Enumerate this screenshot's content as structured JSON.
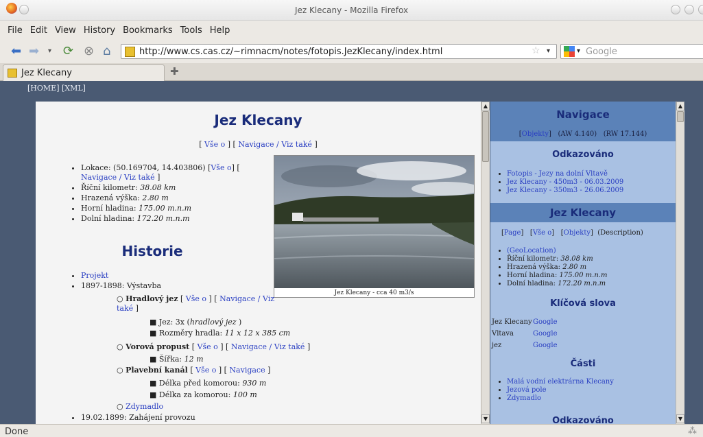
{
  "window": {
    "title": "Jez Klecany - Mozilla Firefox"
  },
  "menu": {
    "items": [
      "File",
      "Edit",
      "View",
      "History",
      "Bookmarks",
      "Tools",
      "Help"
    ]
  },
  "nav": {
    "url": "http://www.cs.cas.cz/~rimnacm/notes/fotopis.JezKlecany/index.html",
    "search_placeholder": "Google"
  },
  "tab": {
    "title": "Jez Klecany"
  },
  "page": {
    "home_links": "[HOME] [XML]",
    "title": "Jez Klecany",
    "top_links": {
      "l1": "Vše o",
      "l2": "Navigace / Viz také"
    },
    "loc": {
      "text": "Lokace: (50.169704, 14.403806) [",
      "l1": "Vše o",
      "mid": "] [",
      "l2": "Navigace / Viz také",
      "end": "]"
    },
    "facts": [
      {
        "label": "Říční kilometr: ",
        "value": "38.08 km"
      },
      {
        "label": "Hrazená výška: ",
        "value": "2.80 m"
      },
      {
        "label": "Horní hladina: ",
        "value": "175.00 m.n.m"
      },
      {
        "label": "Dolní hladina: ",
        "value": "172.20 m.n.m"
      }
    ],
    "photo_caption": "Jez Klecany - cca 40 m3/s",
    "history_title": "Historie",
    "history": {
      "projekt": "Projekt",
      "year1": "1897-1898: Výstavba",
      "hradlovy": {
        "name": "Hradlový jez",
        "l1": "Vše o",
        "l2": "Navigace / Viz také"
      },
      "jez": {
        "label": "Jez: 3x (",
        "value": "hradlový jez",
        "end": " )"
      },
      "rozmery": {
        "label": "Rozměry hradla: ",
        "value": "11 x 12 x 385 cm"
      },
      "vorova": {
        "name": "Vorová propust",
        "l1": "Vše o",
        "l2": "Navigace / Viz také"
      },
      "sirka": {
        "label": "Šířka: ",
        "value": "12 m"
      },
      "plavebni": {
        "name": "Plavební kanál",
        "l1": "Vše o",
        "l2": "Navigace"
      },
      "delka_pred": {
        "label": "Délka před komorou: ",
        "value": "930 m"
      },
      "delka_za": {
        "label": "Délka za komorou: ",
        "value": "100 m"
      },
      "zdymadlo": "Zdymadlo",
      "year2": "19.02.1899: Zahájení provozu"
    }
  },
  "side": {
    "nav_title": "Navigace",
    "nav_row": {
      "objekty": "Objekty",
      "aw": "(AW 4.140)",
      "rw": "(RW 17.144)"
    },
    "odkaz_title": "Odkazováno",
    "odkaz": [
      "Fotopis - Jezy na dolní Vltavě",
      "Jez Klecany - 450m3 - 06.03.2009",
      "Jez Klecany - 350m3 - 26.06.2009"
    ],
    "jez_title": "Jez Klecany",
    "jez_row": {
      "page": "Page",
      "vse": "Vše o",
      "objekty": "Objekty",
      "desc": "(Description)"
    },
    "jez_items": {
      "geo": "(GeoLocation)",
      "km": {
        "label": "Říční kilometr: ",
        "value": "38.08 km"
      },
      "vyska": {
        "label": "Hrazená výška: ",
        "value": "2.80 m"
      },
      "horni": {
        "label": "Horní hladina: ",
        "value": "175.00 m.n.m"
      },
      "dolni": {
        "label": "Dolní hladina: ",
        "value": "172.20 m.n.m"
      }
    },
    "kw_title": "Klíčová slova",
    "keywords": [
      {
        "word": "Jez Klecany",
        "link": "Google"
      },
      {
        "word": "Vltava",
        "link": "Google"
      },
      {
        "word": "jez",
        "link": "Google"
      }
    ],
    "casti_title": "Části",
    "casti": [
      "Malá vodní elektrárna Klecany",
      "Jezová pole",
      "Zdymadlo"
    ],
    "odkaz2_title": "Odkazováno"
  },
  "status": "Done"
}
